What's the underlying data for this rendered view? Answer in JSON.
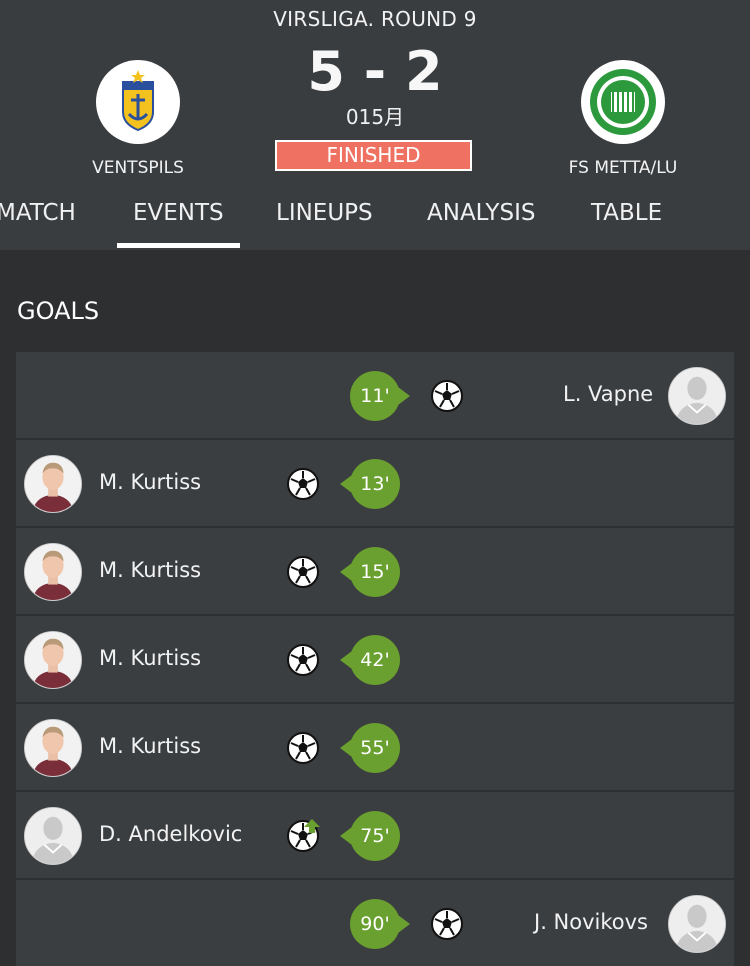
{
  "match": {
    "round": "VIRSLIGA. ROUND 9",
    "score": "5 - 2",
    "date": "015月",
    "status": "FINISHED",
    "home_team": "VENTSPILS",
    "away_team": "FS METTA/LU"
  },
  "tabs": [
    "MATCH",
    "EVENTS",
    "LINEUPS",
    "ANALYSIS",
    "TABLE"
  ],
  "active_tab": "EVENTS",
  "section_title": "GOALS",
  "goals": [
    {
      "side": "away",
      "player": "L. Vapne",
      "minute": "11'",
      "type": "goal"
    },
    {
      "side": "home",
      "player": "M. Kurtiss",
      "minute": "13'",
      "type": "goal"
    },
    {
      "side": "home",
      "player": "M. Kurtiss",
      "minute": "15'",
      "type": "goal"
    },
    {
      "side": "home",
      "player": "M. Kurtiss",
      "minute": "42'",
      "type": "goal"
    },
    {
      "side": "home",
      "player": "M. Kurtiss",
      "minute": "55'",
      "type": "goal"
    },
    {
      "side": "home",
      "player": "D. Andelkovic",
      "minute": "75'",
      "type": "own-goal"
    },
    {
      "side": "away",
      "player": "J. Novikovs",
      "minute": "90'",
      "type": "goal"
    }
  ],
  "colors": {
    "status": "#ef7162",
    "minute_badge": "#69a030",
    "row_bg": "#3b3e41"
  }
}
